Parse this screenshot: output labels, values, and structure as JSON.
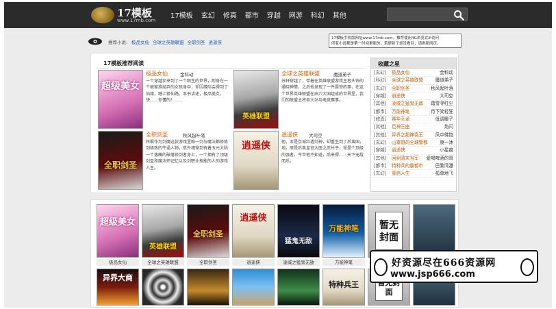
{
  "header": {
    "logo_title": "17模板",
    "logo_url": "www.17mb.com",
    "nav": [
      "17模板",
      "玄幻",
      "修真",
      "都市",
      "穿越",
      "网游",
      "科幻",
      "其他"
    ]
  },
  "notice": {
    "label": "推荐小说:",
    "links": [
      "极品女仙",
      "全球之英雄联盟",
      "全职剑圣",
      "逍遥侠"
    ],
    "box_line1": "17模板手机版网址www.17mb.com，推荐使用4G浏览式ifi访问",
    "box_line2": "所有小说都是第一时间更新的，若更新了却没看到，请刷新网页。"
  },
  "recommend": {
    "title": "17模板推荐阅读",
    "books": [
      {
        "title": "极品女仙",
        "author": "金科动",
        "cover_text": "超级美女",
        "desc": "一个穿越女来到了一个陌生的世界，附身在一个被家族抛弃的女孩身中，却因缘际会得到了仙缘，踏上修仙路，本书讲述，极品美女，快……你懂的！……"
      },
      {
        "title": "全球之英雄联盟",
        "author": "魔道弟子",
        "cover_text": "英雄联盟",
        "desc": "苏轩穿越了，带着在英雄联盟游戏主者头饰的通晓神情，之后他发现了一件震惊的事，在这个世界英雄联盟在由六大国组成的世界里，我们的联盟主将各大站与电竞赛事。"
      },
      {
        "title": "全职剑圣",
        "author": "秋风起叶落",
        "cover_text": "全职剑圣",
        "desc": "林枫作为剑魔这款游戏里唯一剑与魔法都修炼到极致的牛逼人物，意外魂穿到有着五元大陆一个落魄的破落修剑者身上，一个拥有了顶级剑圣和魔法师记忆以及剑职业技能的人的游戏人生。"
      },
      {
        "title": "逍遥侠",
        "author": "大司空",
        "cover_text": "逍遥侠",
        "desc": "他，本是京城红透剑神，却重生到了后蛮国，地，原是后蛮皇宫太医之庶长子，却是个顶级的强者，今世他不知道，后来得……天下无敌而后，"
      }
    ]
  },
  "sidebar": {
    "title": "收藏之星",
    "rows": [
      {
        "cat": "[玄幻]",
        "name": "极品女仙",
        "author": "金科动"
      },
      {
        "cat": "[科幻]",
        "name": "全球之英雄联盟",
        "author": "魔道弟子"
      },
      {
        "cat": "[玄幻]",
        "name": "全职剑圣",
        "author": "秋风起叶落"
      },
      {
        "cat": "[穿越]",
        "name": "逍遥侠",
        "author": "大司空"
      },
      {
        "cat": "[其他]",
        "name": "凌威之猛鬼无敌",
        "author": "踏雪寻红尘"
      },
      {
        "cat": "[都市]",
        "name": "万能神笔",
        "author": "月下笑轻狂"
      },
      {
        "cat": "[修真]",
        "name": "赛华天龙",
        "author": "低调椰子"
      },
      {
        "cat": "[其他]",
        "name": "巨神王座",
        "author": "焰闪"
      },
      {
        "cat": "[其他]",
        "name": "异界之超神奏王",
        "author": "风中佛饱"
      },
      {
        "cat": "[玄幻]",
        "name": "山寨盟的全球警都",
        "author": "庚一沐"
      },
      {
        "cat": "[穿越]",
        "name": "逍遥侠",
        "author": "小星痕"
      },
      {
        "cat": "[其他]",
        "name": "回到清末当军",
        "author": "爱喝啤酒的哥"
      },
      {
        "cat": "[都市]",
        "name": "特种兵的霸都市",
        "author": "巴黎湾瀑"
      },
      {
        "cat": "[玄幻]",
        "name": "重启人生",
        "author": "孤单地飞"
      }
    ]
  },
  "grid": {
    "row1": [
      {
        "label": "极品女仙",
        "art": "超级美女"
      },
      {
        "label": "全球之英雄联盟",
        "art": "英雄联盟"
      },
      {
        "label": "全职剑圣",
        "art": "全职剑圣"
      },
      {
        "label": "逍遥侠",
        "art": "逍遥侠"
      },
      {
        "label": "凌威之猛鬼无敌",
        "art": "猛鬼无敌"
      },
      {
        "label": "万能神笔",
        "art": "万能神笔"
      },
      {
        "label": "",
        "art": "暂无封面"
      },
      {
        "label": "",
        "art": ""
      }
    ],
    "row2": [
      {
        "art": "异界大商"
      },
      {
        "art": ""
      },
      {
        "art": ""
      },
      {
        "art": ""
      },
      {
        "art": ""
      },
      {
        "art": "特种兵王"
      },
      {
        "art": "暂无封面"
      },
      {
        "art": ""
      }
    ]
  },
  "watermark": {
    "line1": "好资源尽在666资源网",
    "line2": "www.jsp666.com"
  }
}
